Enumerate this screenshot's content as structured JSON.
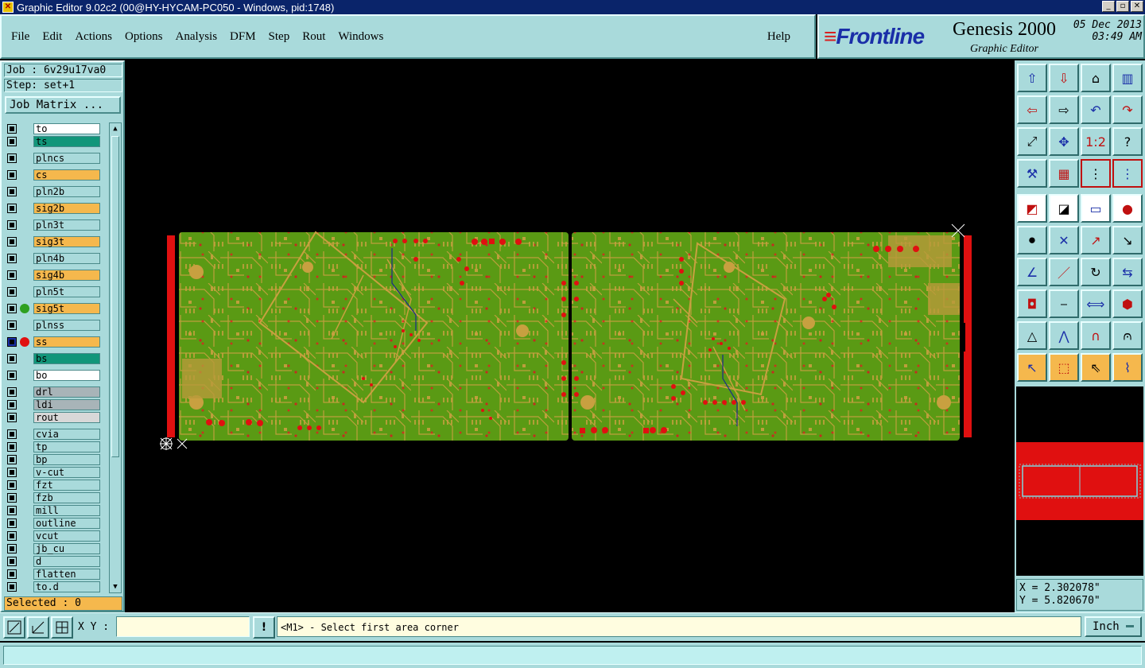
{
  "window": {
    "title": "Graphic Editor 9.02c2 (00@HY-HYCAM-PC050 - Windows, pid:1748)"
  },
  "menu": {
    "items": [
      "File",
      "Edit",
      "Actions",
      "Options",
      "Analysis",
      "DFM",
      "Step",
      "Rout",
      "Windows"
    ],
    "help": "Help"
  },
  "brand": {
    "logo": "Frontline",
    "product": "Genesis 2000",
    "subtitle": "Graphic Editor",
    "date": "05 Dec 2013",
    "time": "03:49 AM"
  },
  "job": {
    "job_label": "Job : 6v29u17va0",
    "step_label": "Step: set+1",
    "matrix_button": "Job Matrix ..."
  },
  "layers": [
    {
      "name": "to",
      "color": "#ffffff"
    },
    {
      "name": "ts",
      "color": "#11967a"
    },
    {
      "name": "plncs",
      "color": "#a9dadb"
    },
    {
      "name": "cs",
      "color": "#f5b84d"
    },
    {
      "name": "pln2b",
      "color": "#a9dadb"
    },
    {
      "name": "sig2b",
      "color": "#f5b84d"
    },
    {
      "name": "pln3t",
      "color": "#a9dadb"
    },
    {
      "name": "sig3t",
      "color": "#f5b84d"
    },
    {
      "name": "pln4b",
      "color": "#a9dadb"
    },
    {
      "name": "sig4b",
      "color": "#f5b84d"
    },
    {
      "name": "pln5t",
      "color": "#a9dadb"
    },
    {
      "name": "sig5t",
      "color": "#f5b84d",
      "status": "green"
    },
    {
      "name": "plnss",
      "color": "#a9dadb"
    },
    {
      "name": "ss",
      "color": "#f5b84d",
      "status": "red",
      "active": true
    },
    {
      "name": "bs",
      "color": "#11967a"
    },
    {
      "name": "bo",
      "color": "#ffffff"
    },
    {
      "name": "drl",
      "color": "#a8b4b8"
    },
    {
      "name": "ldi",
      "color": "#a8b4b8"
    },
    {
      "name": "rout",
      "color": "#d8d8d8"
    },
    {
      "name": "cvia",
      "color": "#a9dadb"
    },
    {
      "name": "tp",
      "color": "#a9dadb"
    },
    {
      "name": "bp",
      "color": "#a9dadb"
    },
    {
      "name": "v-cut",
      "color": "#a9dadb"
    },
    {
      "name": "fzt",
      "color": "#a9dadb"
    },
    {
      "name": "fzb",
      "color": "#a9dadb"
    },
    {
      "name": "mill",
      "color": "#a9dadb"
    },
    {
      "name": "outline",
      "color": "#a9dadb"
    },
    {
      "name": "vcut",
      "color": "#a9dadb"
    },
    {
      "name": "jb_cu",
      "color": "#a9dadb"
    },
    {
      "name": "d",
      "color": "#a9dadb"
    },
    {
      "name": "flatten",
      "color": "#a9dadb"
    },
    {
      "name": "to.d",
      "color": "#a9dadb"
    }
  ],
  "selection": {
    "label": "Selected : 0"
  },
  "coords": {
    "x": "X = 2.302078\"",
    "y": "Y = 5.820670\""
  },
  "bottom": {
    "xy_label": "X Y :",
    "xy_value": "",
    "message": "<M1> - Select first area corner",
    "units": "Inch"
  },
  "toolbox_icons": [
    "to-front-icon",
    "to-back-icon",
    "home-icon",
    "split-view-icon",
    "pan-left-icon",
    "pan-right-icon",
    "undo-icon",
    "redo-icon",
    "zoom-fit-icon",
    "zoom-home-icon",
    "zoom-1to2-icon",
    "help-icon",
    "tools-icon",
    "grid-icon",
    "snap-icon",
    "net-icon",
    "feature-select-icon",
    "measure-icon",
    "ruler-icon",
    "circle-select-icon",
    "connect-icon",
    "delete-icon",
    "move-icon",
    "copy-icon",
    "line-icon",
    "slash-icon",
    "rotate-icon",
    "mirror-icon",
    "pad-icon",
    "cut-icon",
    "dimension-icon",
    "shape-icon",
    "triangle-icon",
    "arc-icon",
    "arch-icon",
    "arch-cross-icon",
    "pointer-icon",
    "select-box-icon",
    "select-icon",
    "route-icon"
  ]
}
